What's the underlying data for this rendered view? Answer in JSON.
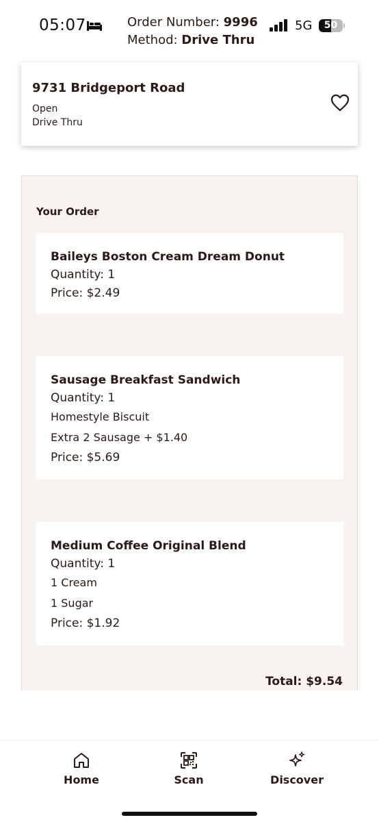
{
  "status_bar": {
    "time": "05:07",
    "network": "5G",
    "battery_level": "50",
    "battery_fraction": 0.5,
    "order_number_label": "Order Number: ",
    "order_number": "9996",
    "method_label": "Method: ",
    "method": "Drive Thru"
  },
  "store": {
    "name": "9731 Bridgeport Road",
    "status": "Open",
    "method": "Drive Thru"
  },
  "order": {
    "heading": "Your Order",
    "items": [
      {
        "name": "Baileys Boston Cream Dream Donut",
        "quantity": "Quantity: 1",
        "modifiers": [],
        "price": "Price: $2.49"
      },
      {
        "name": "Sausage Breakfast Sandwich",
        "quantity": "Quantity: 1",
        "modifiers": [
          "Homestyle Biscuit",
          "Extra 2 Sausage + $1.40"
        ],
        "price": "Price: $5.69"
      },
      {
        "name": "Medium Coffee Original Blend",
        "quantity": "Quantity: 1",
        "modifiers": [
          "1 Cream",
          "1 Sugar"
        ],
        "price": "Price: $1.92"
      }
    ],
    "total": "Total: $9.54"
  },
  "nav": {
    "home": "Home",
    "scan": "Scan",
    "discover": "Discover"
  },
  "colors": {
    "text": "#2b1a17",
    "panel_background": "#f8f3ee",
    "card_background": "#ffffff"
  }
}
